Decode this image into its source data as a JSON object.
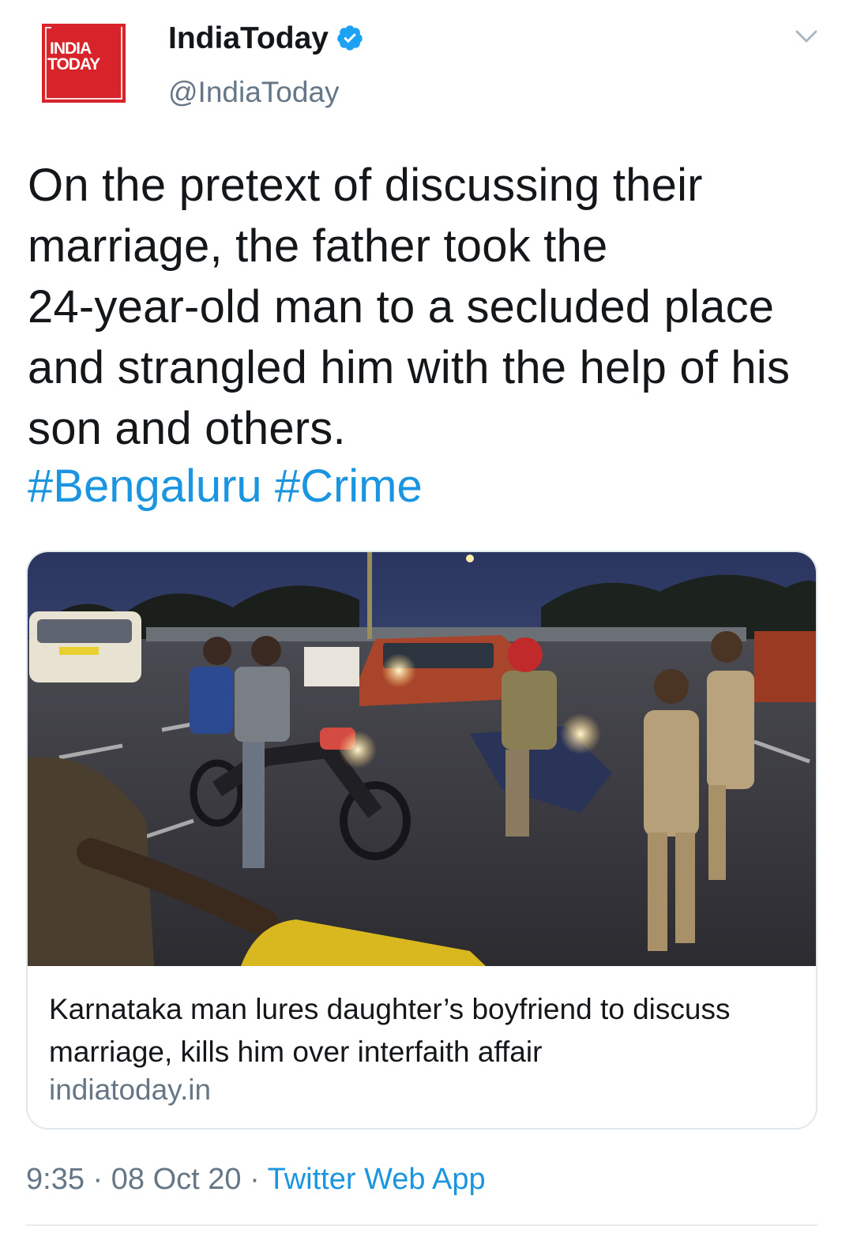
{
  "account": {
    "avatar_logo_line1": "INDIA",
    "avatar_logo_line2": "TODAY",
    "display_name": "IndiaToday",
    "handle": "@IndiaToday",
    "verified": true
  },
  "tweet": {
    "text_lines": [
      "On the pretext of discussing their",
      "marriage, the father took the",
      "24-year-old man to a secluded place",
      "and strangled him with the help of his",
      "son and others."
    ],
    "hashtags": [
      "#Bengaluru",
      "#Crime"
    ]
  },
  "card": {
    "image_icon": "photo-police-checkpoint",
    "title_lines": [
      "Karnataka man lures daughter’s boyfriend to discuss",
      "marriage, kills him over interfaith affair"
    ],
    "domain": "indiatoday.in"
  },
  "meta": {
    "time": "9:35",
    "separator": "·",
    "date": "08 Oct 20",
    "source": "Twitter Web App"
  },
  "colors": {
    "brand_red": "#d8232a",
    "link_blue": "#1b95e0",
    "secondary_gray": "#657786",
    "text": "#14171a"
  },
  "icons": {
    "verified": "verified-badge-icon",
    "menu": "chevron-down-icon"
  }
}
